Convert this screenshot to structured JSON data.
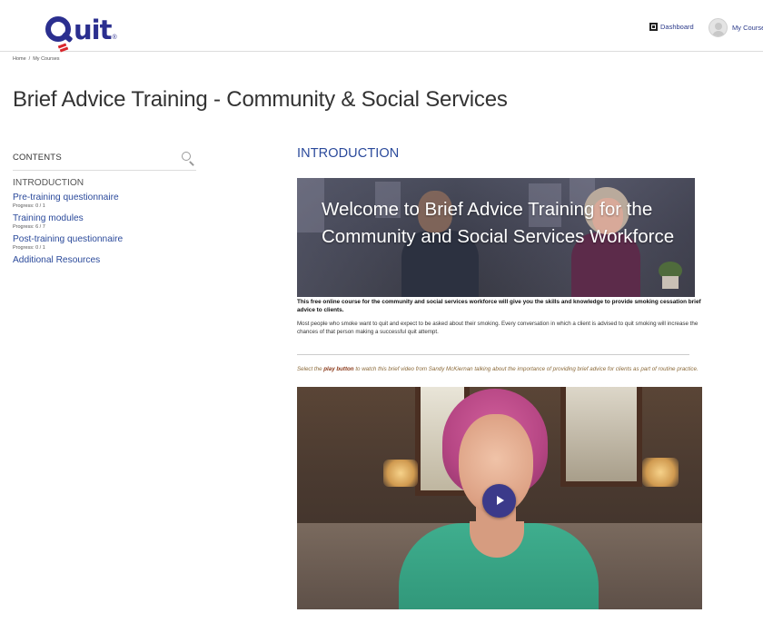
{
  "header": {
    "logo_text": "uit",
    "logo_reg": "®",
    "dashboard_label": "Dashboard",
    "my_courses_label": "My Course"
  },
  "breadcrumb": {
    "home": "Home",
    "separator": "/",
    "current": "My Courses"
  },
  "page_title": "Brief Advice Training - Community & Social Services",
  "sidebar": {
    "contents_label": "CONTENTS",
    "items": [
      {
        "label": "INTRODUCTION",
        "progress": ""
      },
      {
        "label": "Pre-training questionnaire",
        "progress": "Progress: 0 / 1"
      },
      {
        "label": "Training modules",
        "progress": "Progress: 6 / 7"
      },
      {
        "label": "Post-training questionnaire",
        "progress": "Progress: 0 / 1"
      },
      {
        "label": "Additional Resources",
        "progress": ""
      }
    ]
  },
  "main": {
    "section_title": "INTRODUCTION",
    "banner_text": "Welcome to Brief Advice Training for the Community and Social Services Workforce",
    "intro_bold": "This free online course for the community and social services workforce will give you the skills and knowledge to provide smoking cessation brief advice to clients.",
    "intro_text": "Most people who smoke want to quit and expect to be asked about their smoking.  Every conversation in which a client is advised to quit smoking will increase the chances of that person making a successful quit attempt.",
    "instruction_pre": "Select the ",
    "instruction_bold": "play button",
    "instruction_post": " to watch this brief video from Sandy McKiernan talking about the importance of providing brief advice for clients as part of routine practice."
  },
  "colors": {
    "brand_blue": "#2b2f8f",
    "brand_red": "#d9262c",
    "link_blue": "#2b4a9b",
    "play_button": "#3b3a8a"
  }
}
